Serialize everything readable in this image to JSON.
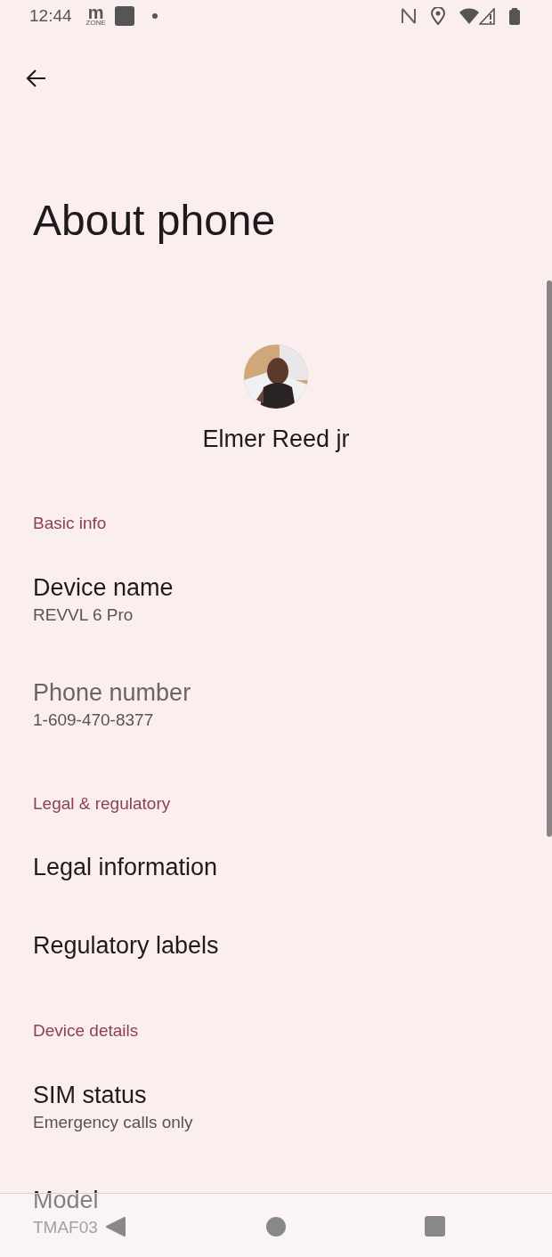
{
  "status_bar": {
    "time": "12:44",
    "app_logo": {
      "letter": "m",
      "caption": "ZONE"
    }
  },
  "header": {
    "title": "About phone"
  },
  "profile": {
    "name": "Elmer Reed jr"
  },
  "sections": [
    {
      "title": "Basic info",
      "items": [
        {
          "title": "Device name",
          "subtitle": "REVVL 6 Pro",
          "disabled": false
        },
        {
          "title": "Phone number",
          "subtitle": "1-609-470-8377",
          "disabled": true
        }
      ]
    },
    {
      "title": "Legal & regulatory",
      "items": [
        {
          "title": "Legal information",
          "disabled": false
        },
        {
          "title": "Regulatory labels",
          "disabled": false
        }
      ]
    },
    {
      "title": "Device details",
      "items": [
        {
          "title": "SIM status",
          "subtitle": "Emergency calls only",
          "disabled": false
        },
        {
          "title": "Model",
          "subtitle": "TMAF03",
          "disabled": false
        }
      ]
    }
  ]
}
